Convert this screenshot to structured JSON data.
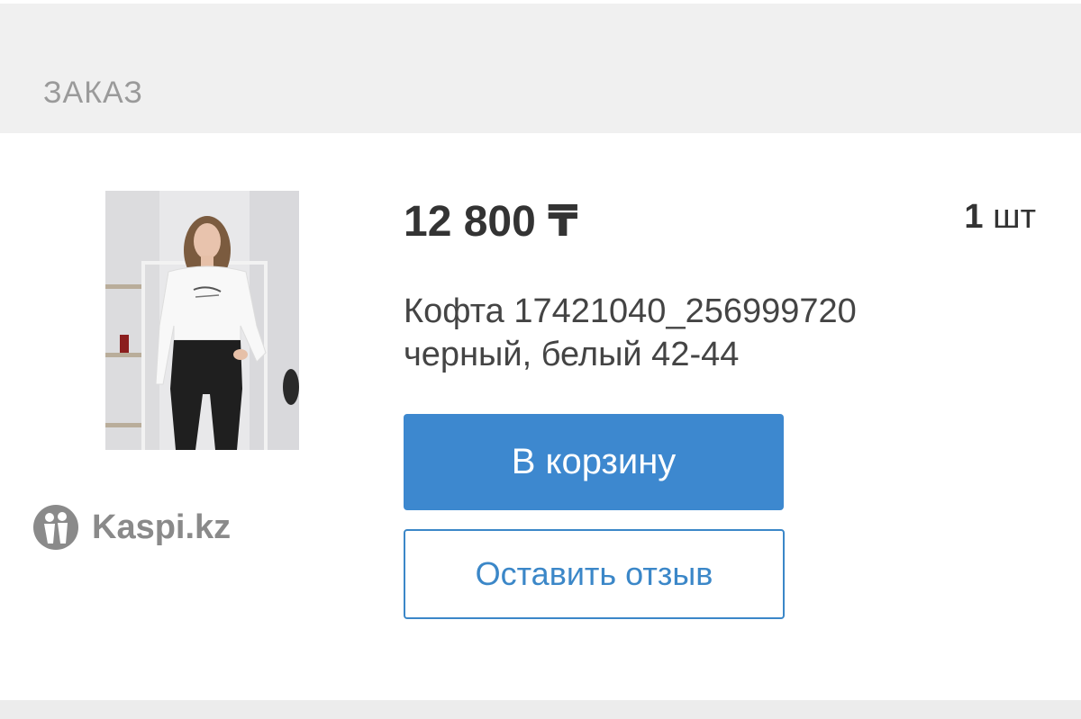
{
  "section": {
    "title": "ЗАКАЗ"
  },
  "order_item": {
    "price": "12 800 ₸",
    "quantity_value": "1",
    "quantity_unit": "шт",
    "title_line1": "Кофта 17421040_256999720",
    "title_line2": "черный, белый 42-44",
    "cart_button_label": "В корзину",
    "review_button_label": "Оставить отзыв",
    "image_alt": "product photo"
  },
  "watermark": {
    "text": "Kaspi.kz"
  },
  "colors": {
    "primary_blue": "#3d88cf",
    "outline_blue": "#3b87c8",
    "header_bg": "#f0f0f0",
    "text_dark": "#333333"
  }
}
